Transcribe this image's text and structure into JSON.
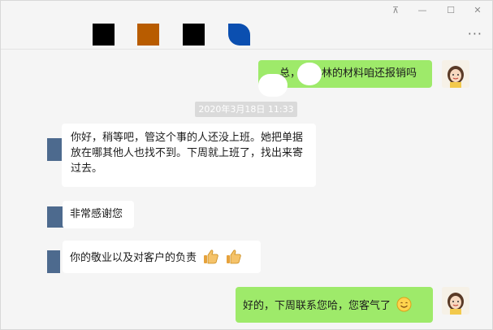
{
  "title_bar": {
    "pin_glyph": "⊼",
    "minimize_glyph": "—",
    "maximize_glyph": "☐",
    "close_glyph": "✕",
    "more_glyph": "···",
    "redaction_colors": [
      "#000000",
      "#b85c00",
      "#000000",
      "#0b4fb0"
    ]
  },
  "messages": {
    "m1": {
      "side": "right",
      "text_a": "总，",
      "text_b": "林的材料咱还报销吗"
    },
    "timestamp": "2020年3月18日 11:33",
    "m2": {
      "side": "left",
      "text": "你好，稍等吧，管这个事的人还没上班。她把单据放在哪其他人也找不到。下周就上班了，找出来寄过去。"
    },
    "m3": {
      "side": "left",
      "text": "非常感谢您"
    },
    "m4": {
      "side": "left",
      "text": "你的敬业以及对客户的负责",
      "emoji": [
        "thumbs-up-icon",
        "thumbs-up-icon"
      ]
    },
    "m5": {
      "side": "right",
      "text": "好的，下周联系您哈，您客气了",
      "emoji": [
        "smile-icon"
      ]
    }
  },
  "colors": {
    "green_bubble": "#9eea6a",
    "white_bubble": "#ffffff",
    "timestamp_bg": "#dadada"
  }
}
